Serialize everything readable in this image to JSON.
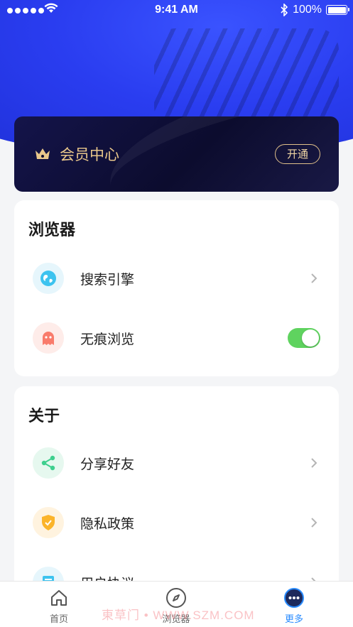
{
  "status_bar": {
    "time": "9:41 AM",
    "battery": "100%"
  },
  "vip": {
    "title": "会员中心",
    "button": "开通"
  },
  "browser_section": {
    "title": "浏览器",
    "items": [
      {
        "label": "搜索引擎",
        "icon": "globe-icon",
        "control": "chevron"
      },
      {
        "label": "无痕浏览",
        "icon": "ghost-icon",
        "control": "toggle",
        "toggle_on": true
      }
    ]
  },
  "about_section": {
    "title": "关于",
    "items": [
      {
        "label": "分享好友",
        "icon": "share-icon"
      },
      {
        "label": "隐私政策",
        "icon": "shield-icon"
      },
      {
        "label": "用户协议",
        "icon": "document-icon"
      }
    ]
  },
  "tabbar": {
    "items": [
      {
        "label": "首页",
        "icon": "home-icon"
      },
      {
        "label": "浏览器",
        "icon": "compass-icon"
      },
      {
        "label": "更多",
        "icon": "more-icon",
        "active": true
      }
    ]
  },
  "watermark": "東草门 • WWW.SZM.COM",
  "colors": {
    "hero": "#2a3df0",
    "accent": "#2a8cff",
    "gold": "#e9c78b",
    "toggle_on": "#5fd35f"
  }
}
